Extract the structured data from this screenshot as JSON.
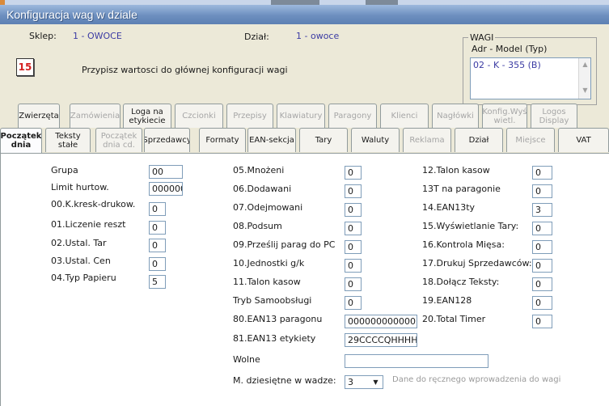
{
  "window": {
    "title": "Konfiguracja wag w dziale"
  },
  "header": {
    "sklep_label": "Sklep:",
    "sklep_value": "1 - OWOCE",
    "dzial_label": "Dział:",
    "dzial_value": "1 - owoce",
    "calendar_text": "15",
    "assign_text": "Przypisz wartosci do głównej konfiguracji wagi"
  },
  "wagi": {
    "legend": "WAGI",
    "subheader": "Adr - Model (Typ)",
    "items": [
      "02 - K - 355 (B)"
    ]
  },
  "tabs_back": [
    {
      "label": "Zwierzęta",
      "enabled": true
    },
    {
      "label": "Zamówienia",
      "enabled": false
    },
    {
      "label": "Loga na etykiecie",
      "enabled": true
    },
    {
      "label": "Czcionki",
      "enabled": false
    },
    {
      "label": "Przepisy",
      "enabled": false
    },
    {
      "label": "Klawiatury",
      "enabled": false
    },
    {
      "label": "Paragony",
      "enabled": false
    },
    {
      "label": "Klienci",
      "enabled": false
    },
    {
      "label": "Nagłówki",
      "enabled": false
    },
    {
      "label": "Konfig.Wyś wietl.",
      "enabled": false
    },
    {
      "label": "Logos Display",
      "enabled": false
    }
  ],
  "tabs_front": [
    {
      "label": "Początek dnia",
      "active": true,
      "enabled": true
    },
    {
      "label": "Teksty stałe",
      "enabled": true
    },
    {
      "label": "Początek dnia cd.",
      "enabled": false
    },
    {
      "label": "Sprzedawcy",
      "enabled": true
    },
    {
      "label": "Formaty",
      "enabled": true
    },
    {
      "label": "EAN-sekcja",
      "enabled": true
    },
    {
      "label": "Tary",
      "enabled": true
    },
    {
      "label": "Waluty",
      "enabled": true
    },
    {
      "label": "Reklama",
      "enabled": false
    },
    {
      "label": "Dział",
      "enabled": true
    },
    {
      "label": "Miejsce",
      "enabled": false
    },
    {
      "label": "VAT",
      "enabled": true
    }
  ],
  "form": {
    "col1": [
      {
        "label": "Grupa",
        "value": "00"
      },
      {
        "label": "Limit hurtow.",
        "value": "000000"
      },
      {
        "label": "00.K.kresk-drukow.",
        "value": "0"
      },
      {
        "label": "01.Liczenie reszt",
        "value": "0"
      },
      {
        "label": "02.Ustal. Tar",
        "value": "0"
      },
      {
        "label": "03.Ustal. Cen",
        "value": "0"
      },
      {
        "label": "04.Typ Papieru",
        "value": "5"
      }
    ],
    "col2": [
      {
        "label": "05.Mnożeni",
        "value": "0"
      },
      {
        "label": "06.Dodawani",
        "value": "0"
      },
      {
        "label": "07.Odejmowani",
        "value": "0"
      },
      {
        "label": "08.Podsum",
        "value": "0"
      },
      {
        "label": "09.Prześlij parag do PC",
        "value": "0"
      },
      {
        "label": "10.Jednostki g/k",
        "value": "0"
      },
      {
        "label": "11.Talon  kasow",
        "value": "0"
      },
      {
        "label": "Tryb Samoobsługi",
        "value": "0"
      }
    ],
    "ean13_paragonu_label": "80.EAN13 paragonu",
    "ean13_paragonu_value": "000000000000",
    "ean13_etykiety_label": "81.EAN13 etykiety",
    "ean13_etykiety_value": "29CCCCQHHHH",
    "wolne_label": "Wolne",
    "wolne_value": "",
    "decimal_label": "M. dziesiętne w wadze:",
    "decimal_value": "3",
    "manual_note": "Dane do ręcznego wprowadzenia do wagi",
    "col3": [
      {
        "label": "12.Talon kasow",
        "value": "0"
      },
      {
        "label": "13T na paragonie",
        "value": "0"
      },
      {
        "label": "14.EAN13ty",
        "value": "3"
      },
      {
        "label": "15.Wyświetlanie Tary:",
        "value": "0"
      },
      {
        "label": "16.Kontrola Mięsa:",
        "value": "0"
      },
      {
        "label": "17.Drukuj Sprzedawców:",
        "value": "0"
      },
      {
        "label": "18.Dołącz Teksty:",
        "value": "0"
      },
      {
        "label": "19.EAN128",
        "value": "0"
      },
      {
        "label": "20.Total Timer",
        "value": "0"
      }
    ]
  },
  "colors": {
    "title_bar": "#6d8fbf",
    "value_blue": "#3b3ba3",
    "disabled_text": "#a6a6a6"
  }
}
